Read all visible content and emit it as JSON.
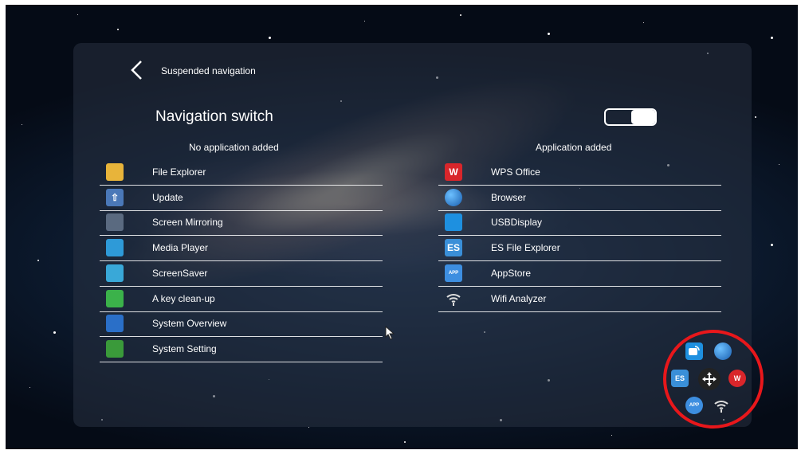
{
  "header": {
    "title": "Suspended navigation"
  },
  "switch": {
    "label": "Navigation switch",
    "enabled": true
  },
  "left_column": {
    "heading": "No application added",
    "items": [
      {
        "label": "File Explorer",
        "icon": "folder-icon",
        "color": "#e8b43a"
      },
      {
        "label": "Update",
        "icon": "update-arrow-icon",
        "color": "#4a78b8"
      },
      {
        "label": "Screen Mirroring",
        "icon": "screen-mirroring-icon",
        "color": "#5a6a80"
      },
      {
        "label": "Media Player",
        "icon": "media-player-icon",
        "color": "#2e9ad8"
      },
      {
        "label": "ScreenSaver",
        "icon": "screensaver-icon",
        "color": "#39a8d8"
      },
      {
        "label": "A key clean-up",
        "icon": "broom-icon",
        "color": "#3bb24a"
      },
      {
        "label": "System Overview",
        "icon": "overview-icon",
        "color": "#2a6fc8"
      },
      {
        "label": "System Setting",
        "icon": "gear-icon",
        "color": "#3a9a3a"
      }
    ]
  },
  "right_column": {
    "heading": "Application added",
    "items": [
      {
        "label": "WPS Office",
        "icon": "wps-icon",
        "color": "#d9262b"
      },
      {
        "label": "Browser",
        "icon": "globe-icon",
        "color": "#2a7fd4"
      },
      {
        "label": "USBDisplay",
        "icon": "usb-display-icon",
        "color": "#1e90e0"
      },
      {
        "label": "ES File Explorer",
        "icon": "es-file-icon",
        "color": "#3a8fd8"
      },
      {
        "label": "AppStore",
        "icon": "appstore-icon",
        "color": "#3d8ee0"
      },
      {
        "label": "Wifi Analyzer",
        "icon": "wifi-icon",
        "color": "#cfd6dc"
      }
    ]
  },
  "floating_nav": {
    "highlight_color": "#e8171b",
    "icons": [
      "usb-display-icon",
      "globe-icon",
      "es-file-icon",
      "move-arrows-icon",
      "wps-icon",
      "appstore-icon",
      "wifi-icon"
    ]
  },
  "glyphs": {
    "update": "⇧",
    "wps": "W",
    "es": "ES",
    "app": "APP"
  }
}
